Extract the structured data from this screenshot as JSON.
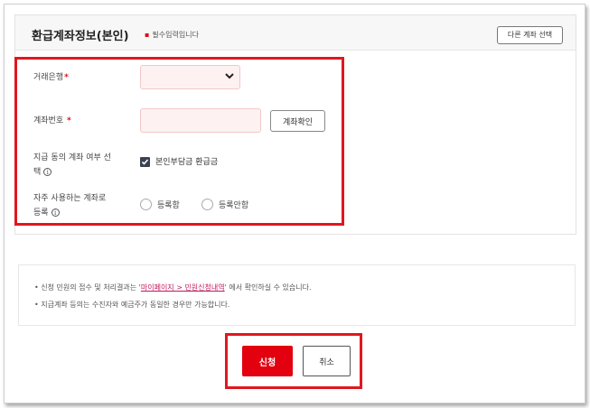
{
  "panel": {
    "title": "환급계좌정보(본인)",
    "required_note": "필수입력입니다",
    "other_account_button": "다른 계좌 선택"
  },
  "form": {
    "bank": {
      "label": "거래은행",
      "value": ""
    },
    "account_number": {
      "label": "계좌번호",
      "value": "",
      "verify_button": "계좌확인"
    },
    "consent": {
      "label_line1": "지급 동의 계좌 여부 선",
      "label_line2": "택",
      "checkbox_label": "본인부담금 환급금",
      "checked": true
    },
    "frequent_account": {
      "label_line1": "자주 사용하는 계좌로",
      "label_line2": "등록",
      "options": [
        "등록함",
        "등록안함"
      ]
    }
  },
  "notices": {
    "line1_prefix": "신청 민원의 접수 및 처리결과는 '",
    "line1_link": "마이페이지 > 민원신청내역",
    "line1_suffix": "' 에서 확인하실 수 있습니다.",
    "line2": "지급계좌 등의는 수진자와 예금주가 동일한 경우만 가능합니다."
  },
  "actions": {
    "submit_label": "신청",
    "cancel_label": "취소"
  },
  "colors": {
    "accent_red": "#e3000f",
    "highlight_red": "#e0171f",
    "input_pink": "#fdf1f1"
  }
}
